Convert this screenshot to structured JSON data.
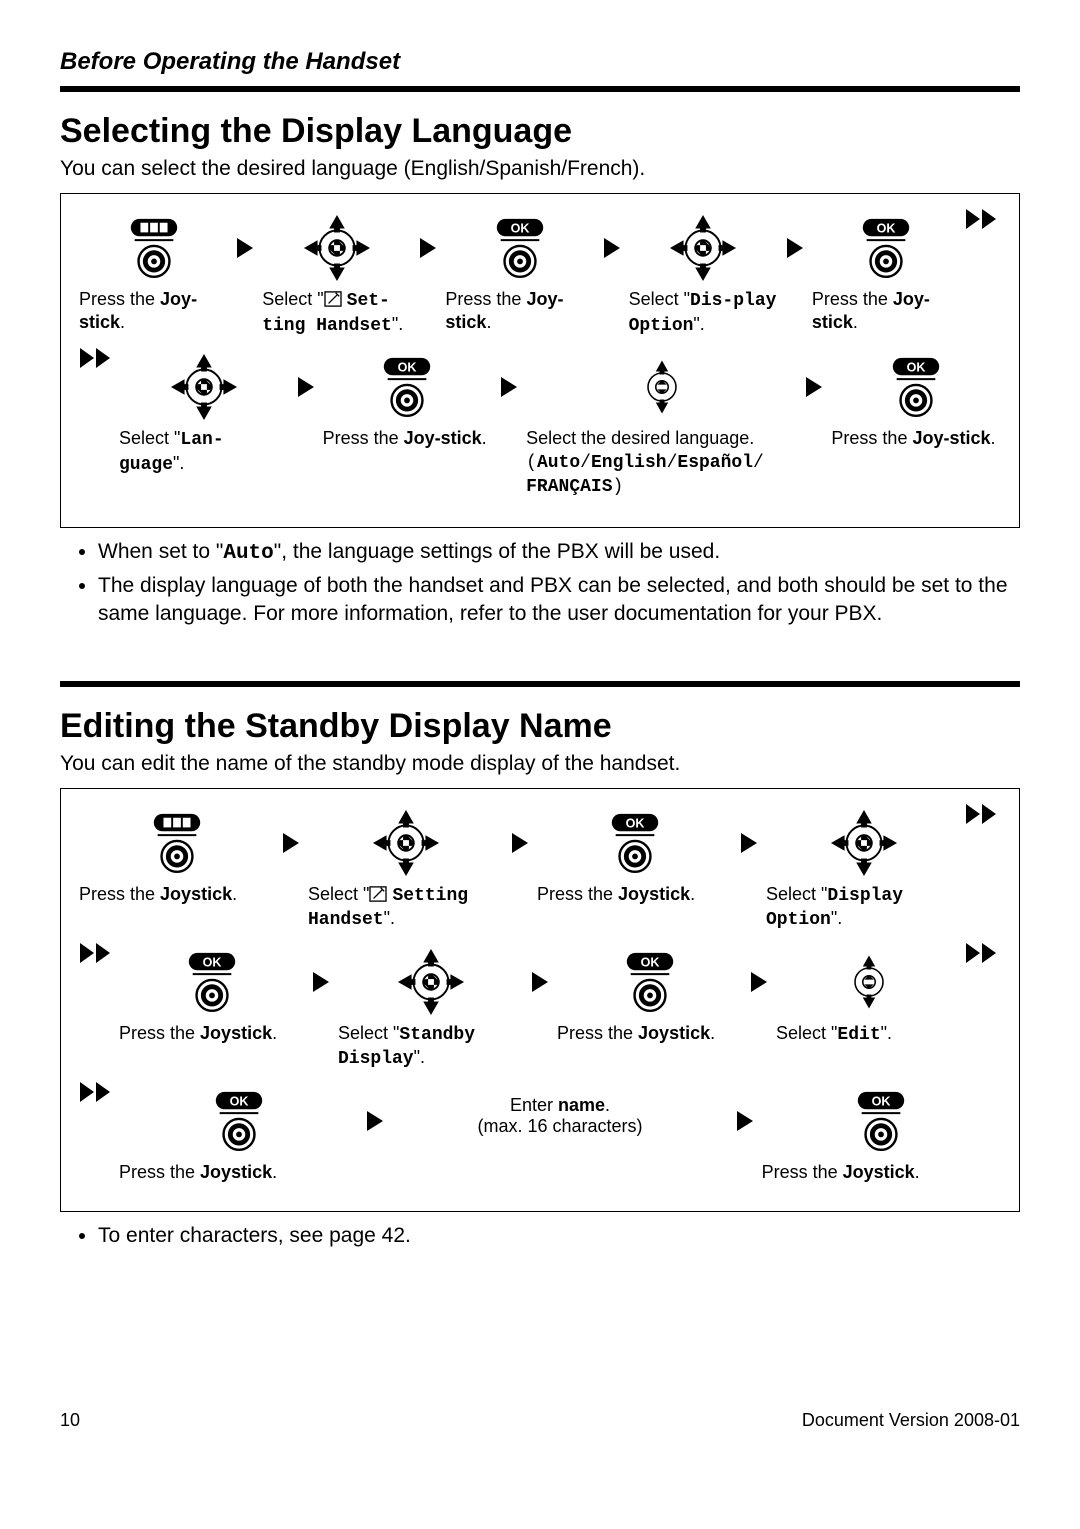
{
  "breadcrumb": "Before Operating the Handset",
  "section1": {
    "title": "Selecting the Display Language",
    "intro": "You can select the desired language (English/Spanish/French).",
    "steps": {
      "r1c1_a": "Press the ",
      "r1c1_b": "Joy-stick",
      "r1c1_c": ".",
      "r1c2_a": "Select \"",
      "r1c2_b": "Set-ting Handset",
      "r1c2_c": "\".",
      "r1c3_a": "Press the ",
      "r1c3_b": "Joy-stick",
      "r1c3_c": ".",
      "r1c4_a": "Select \"",
      "r1c4_b": "Dis-play Option",
      "r1c4_c": "\".",
      "r1c5_a": "Press the ",
      "r1c5_b": "Joy-stick",
      "r1c5_c": ".",
      "r2c1_a": "Select \"",
      "r2c1_b": "Lan-guage",
      "r2c1_c": "\".",
      "r2c2_a": "Press the ",
      "r2c2_b": "Joy-stick",
      "r2c2_c": ".",
      "r2c3_a": "Select the desired language.",
      "r2c3_b": "(Auto/English/Español/ FRANÇAIS)",
      "r2c4_a": "Press the ",
      "r2c4_b": "Joy-stick",
      "r2c4_c": "."
    },
    "notes": {
      "n1_a": "When set to \"",
      "n1_b": "Auto",
      "n1_c": "\", the language settings of the PBX will be used.",
      "n2": "The display language of both the handset and PBX can be selected, and both should be set to the same language. For more information, refer to the user documentation for your PBX."
    }
  },
  "section2": {
    "title": "Editing the Standby Display Name",
    "intro": "You can edit the name of the standby mode display of the handset.",
    "steps": {
      "r1c1_a": "Press the ",
      "r1c1_b": "Joystick",
      "r1c1_c": ".",
      "r1c2_a": "Select \"",
      "r1c2_b": "Setting Handset",
      "r1c2_c": "\".",
      "r1c3_a": "Press the ",
      "r1c3_b": "Joystick",
      "r1c3_c": ".",
      "r1c4_a": "Select \"",
      "r1c4_b": "Display Option",
      "r1c4_c": "\".",
      "r2c1_a": "Press the ",
      "r2c1_b": "Joystick",
      "r2c1_c": ".",
      "r2c2_a": "Select \"",
      "r2c2_b": "Standby Display",
      "r2c2_c": "\".",
      "r2c3_a": "Press the ",
      "r2c3_b": "Joystick",
      "r2c3_c": ".",
      "r2c4_a": "Select \"",
      "r2c4_b": "Edit",
      "r2c4_c": "\".",
      "r3c1_a": "Press the ",
      "r3c1_b": "Joystick",
      "r3c1_c": ".",
      "r3c2_a": "Enter ",
      "r3c2_b": "name",
      "r3c2_c": ".",
      "r3c2_d": "(max. 16 characters)",
      "r3c3_a": "Press the ",
      "r3c3_b": "Joystick",
      "r3c3_c": "."
    },
    "notes": {
      "n1": "To enter characters, see page 42."
    }
  },
  "footer": {
    "page": "10",
    "version": "Document Version  2008-01"
  }
}
